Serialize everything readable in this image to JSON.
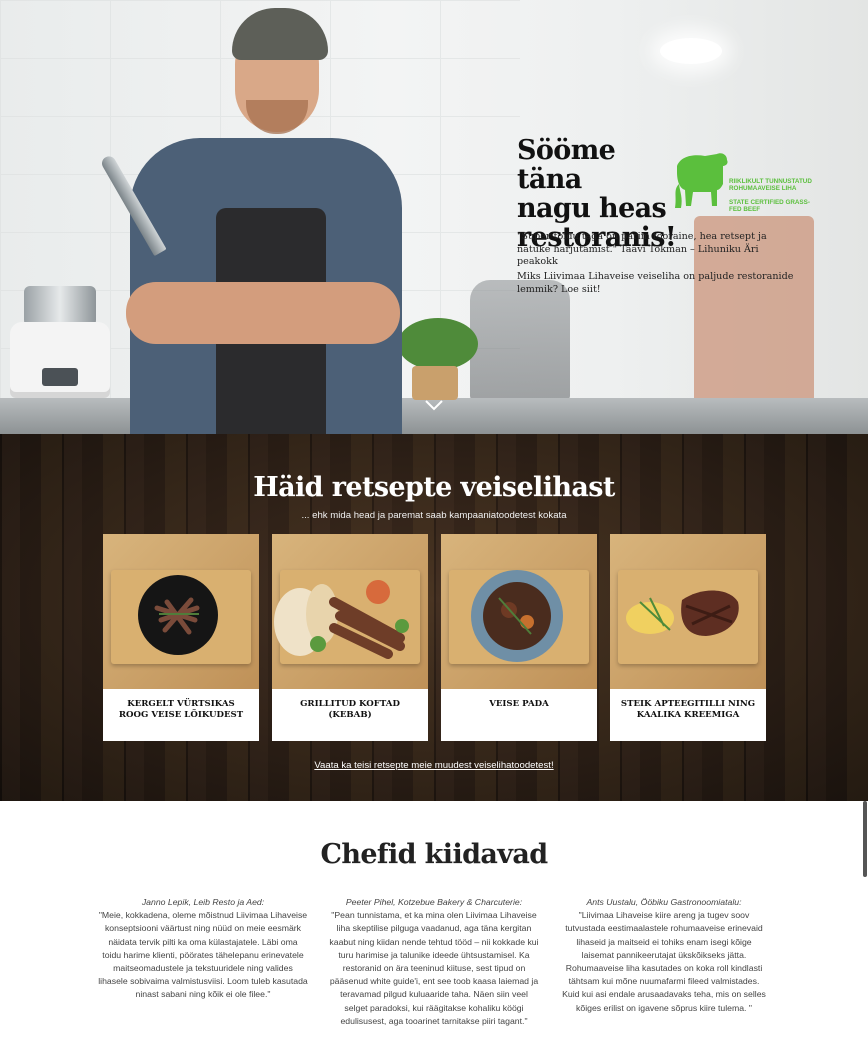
{
  "hero": {
    "title": "Sööme täna\nnagu heas\nrestoranis!",
    "badge": {
      "line1": "RIIKLIKULT TUNNUSTATUD ROHUMAAVEISE LIHA",
      "line2": "STATE CERTIFIED GRASS-FED BEEF",
      "color": "#5bbf3d"
    },
    "quote": "\"Super toidu taga on parim tooraine, hea retsept ja natuke harjutamist.\" Taavi Tokman – Lihuniku Äri peakokk",
    "lead": "Miks Liivimaa Lihaveise veiseliha on paljude restoranide lemmik? Loe siit!",
    "scroll_icon": "chevron-down-icon"
  },
  "recipes": {
    "title": "Häid retsepte veiselihast",
    "subtitle": "... ehk mida head ja paremat saab kampaaniatoodetest kokata",
    "cards": [
      {
        "label": "KERGELT VÜRTSIKAS ROOG VEISE LÕIKUDEST"
      },
      {
        "label": "GRILLITUD KOFTAD (KEBAB)"
      },
      {
        "label": "VEISE PADA"
      },
      {
        "label": "STEIK APTEEGITILLI NING KAALIKA KREEMIGA"
      }
    ],
    "more_link": "Vaata ka teisi retsepte meie muudest veiselihatoodetest!"
  },
  "chefs": {
    "title": "Chefid kiidavad",
    "testimonials": [
      {
        "name": "Janno Lepik, Leib Resto ja Aed:",
        "text": "\"Meie, kokkadena, oleme mõistnud Liivimaa Lihaveise konseptsiooni väärtust ning nüüd on meie eesmärk näidata tervik pilti ka oma külastajatele. Läbi oma toidu harime klienti, pöörates tähelepanu erinevatele maitseomadustele ja tekstuuridele ning valides lihasele sobivaima valmistusviisi. Loom tuleb kasutada ninast sabani ning kõik ei ole filee.\""
      },
      {
        "name": "Peeter Pihel, Kotzebue Bakery & Charcuterie:",
        "text": "\"Pean tunnistama, et ka mina olen Liivimaa Lihaveise liha skeptilise pilguga vaadanud, aga täna kergitan kaabut ning kiidan nende tehtud tööd – nii kokkade kui turu harimise ja talunike ideede ühtsustamisel. Ka restoranid on ära teeninud kiituse, sest tipud on pääsenud white guide'i, ent see toob kaasa laiemad ja teravamad pilgud kuluaaride taha. Näen siin veel selget paradoksi, kui räägitakse kohaliku köögi edulisusest, aga tooarinet tarnitakse piiri tagant.\""
      },
      {
        "name": "Ants Uustalu, Ööbiku Gastronoomiatalu:",
        "text": "\"Liivimaa Lihaveise kiire areng ja tugev soov tutvustada eestimaalastele rohumaaveise erinevaid lihaseid ja maitseid ei tohiks enam isegi kõige laisemat pannikeerutajat ükskõikseks jätta. Rohumaaveise liha kasutades on koka roll kindlasti tähtsam kui mõne nuumafarmi fileed valmistades. Kuid kui asi endale arusaadavaks teha, mis on selles kõiges erilist on igavene sõprus kiire tulema. \""
      }
    ]
  }
}
